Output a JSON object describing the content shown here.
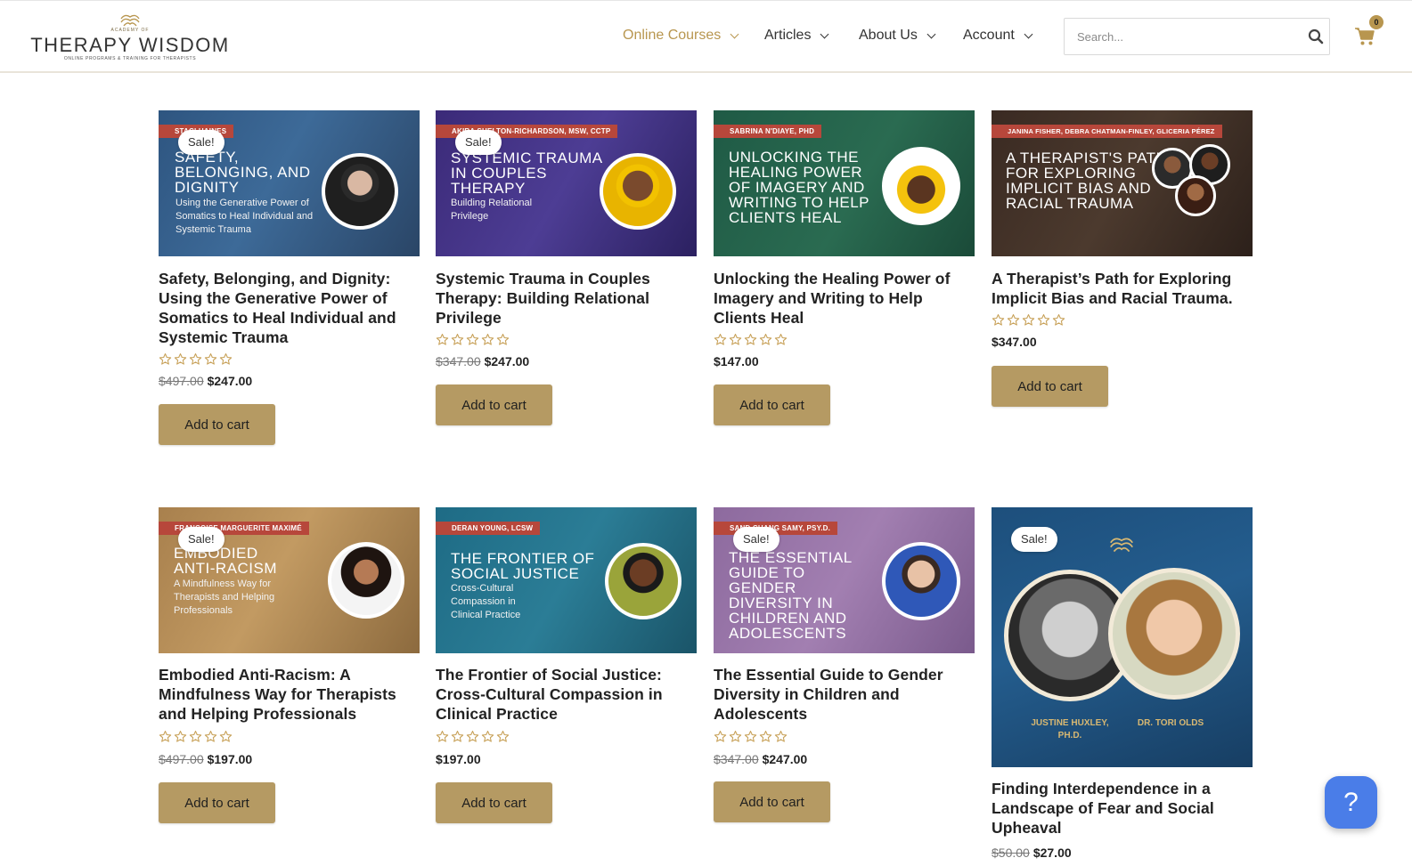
{
  "logo": {
    "academy": "ACADEMY OF",
    "title": "THERAPY WISDOM",
    "tagline": "ONLINE PROGRAMS & TRAINING FOR THERAPISTS"
  },
  "nav": {
    "items": [
      {
        "label": "Online Courses",
        "active": true
      },
      {
        "label": "Articles",
        "active": false
      },
      {
        "label": "About Us",
        "active": false
      },
      {
        "label": "Account",
        "active": false
      }
    ]
  },
  "search": {
    "placeholder": "Search...",
    "icon": "search-icon"
  },
  "cart": {
    "count": "0",
    "icon": "cart-icon"
  },
  "sale_label": "Sale!",
  "add_to_cart_label": "Add to cart",
  "help": {
    "icon": "question-icon",
    "glyph": "?"
  },
  "colors": {
    "accent": "#b8964f",
    "button": "#b59a63",
    "tag_red": "#b7473b",
    "help_blue": "#4a7de8"
  },
  "products": [
    {
      "thumb_name": "STACI HAINES",
      "thumb_title": "SAFETY, BELONGING, AND DIGNITY",
      "thumb_subtitle": "Using the Generative Power of Somatics to Heal Individual and Systemic Trauma",
      "title": "Safety, Belonging, and Dignity: Using the Generative Power of Somatics to Heal Individual and Systemic Trauma",
      "on_sale": true,
      "old_price": "$497.00",
      "price": "$247.00",
      "rating": 0
    },
    {
      "thumb_name": "AKIRA SHELTON-RICHARDSON, MSW, CCTP",
      "thumb_title": "SYSTEMIC TRAUMA IN COUPLES THERAPY",
      "thumb_subtitle": "Building Relational Privilege",
      "title": "Systemic Trauma in Couples Therapy: Building Relational Privilege",
      "on_sale": true,
      "old_price": "$347.00",
      "price": "$247.00",
      "rating": 0
    },
    {
      "thumb_name": "SABRINA N'DIAYE, PHD",
      "thumb_title": "UNLOCKING THE HEALING POWER OF IMAGERY AND WRITING TO HELP CLIENTS HEAL",
      "thumb_subtitle": "",
      "title": "Unlocking the Healing Power of Imagery and Writing to Help Clients Heal",
      "on_sale": false,
      "old_price": "",
      "price": "$147.00",
      "rating": 0
    },
    {
      "thumb_name": "JANINA FISHER, DEBRA CHATMAN-FINLEY, GLICERIA PÉREZ",
      "thumb_title": "A THERAPIST'S PATH FOR EXPLORING IMPLICIT BIAS AND RACIAL TRAUMA",
      "thumb_subtitle": "",
      "title": "A Therapist’s Path for Exploring Implicit Bias and Racial Trauma.",
      "on_sale": false,
      "old_price": "",
      "price": "$347.00",
      "rating": 0
    },
    {
      "thumb_name": "FRANÇOISE MARGUERITE MAXIMÉ",
      "thumb_title": "EMBODIED ANTI-RACISM",
      "thumb_subtitle": "A Mindfulness Way for Therapists and Helping Professionals",
      "title": "Embodied Anti-Racism: A Mindfulness Way for Therapists and Helping Professionals",
      "on_sale": true,
      "old_price": "$497.00",
      "price": "$197.00",
      "rating": 0
    },
    {
      "thumb_name": "DERAN YOUNG, LCSW",
      "thumb_title": "THE FRONTIER OF SOCIAL JUSTICE",
      "thumb_subtitle": "Cross-Cultural Compassion in Clinical Practice",
      "title": "The Frontier of Social Justice: Cross-Cultural Compassion in Clinical Practice",
      "on_sale": false,
      "old_price": "",
      "price": "$197.00",
      "rating": 0
    },
    {
      "thumb_name": "SAND CHANG SAMY, PSY.D.",
      "thumb_title": "THE ESSENTIAL GUIDE TO GENDER DIVERSITY IN CHILDREN AND ADOLESCENTS",
      "thumb_subtitle": "",
      "title": "The Essential Guide to Gender Diversity in Children and Adolescents",
      "on_sale": true,
      "old_price": "$347.00",
      "price": "$247.00",
      "rating": 0
    },
    {
      "thumb_name": "",
      "thumb_title": "",
      "thumb_subtitle": "",
      "thumb_names_left": "JUSTINE HUXLEY, PH.D.",
      "thumb_names_right": "DR. TORI OLDS",
      "title": "Finding Interdependence in a Landscape of Fear and Social Upheaval",
      "on_sale": true,
      "old_price": "$50.00",
      "price": "$27.00",
      "rating": 0
    }
  ]
}
